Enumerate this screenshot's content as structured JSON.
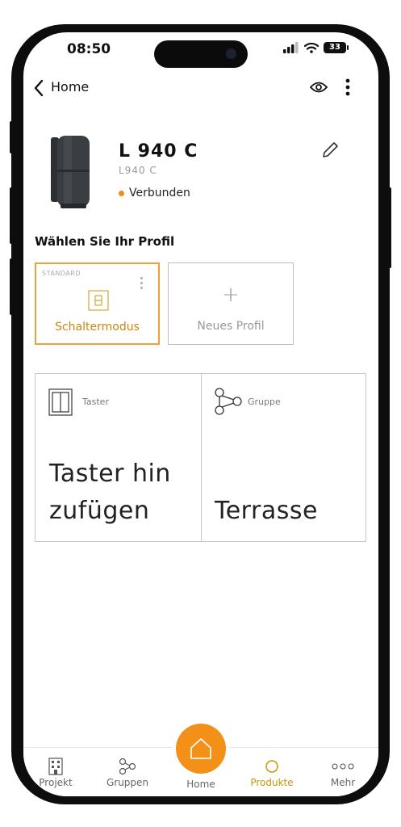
{
  "status_bar": {
    "time": "08:50",
    "battery": "33"
  },
  "nav": {
    "back_label": "Home",
    "eye_icon": "eye-icon",
    "menu_icon": "kebab-icon"
  },
  "device": {
    "name": "L 940 C",
    "model": "L940 C",
    "status": "Verbunden",
    "status_color": "#f08a1c"
  },
  "profile_section": {
    "title": "Wählen Sie Ihr Profil",
    "active": {
      "tag": "STANDARD",
      "label": "Schaltermodus"
    },
    "new_profile": {
      "symbol": "+",
      "label": "Neues Profil"
    }
  },
  "tiles": [
    {
      "small": "Taster",
      "big_line1": "Taster hin",
      "big_line2": "zufügen"
    },
    {
      "small": "Gruppe",
      "big_line1": "Terrasse"
    }
  ],
  "tabbar": {
    "items": [
      {
        "label": "Projekt",
        "icon": "building-icon"
      },
      {
        "label": "Gruppen",
        "icon": "group-icon"
      },
      {
        "label": "Home",
        "icon": "home-icon"
      },
      {
        "label": "Produkte",
        "icon": "circle-icon"
      },
      {
        "label": "Mehr",
        "icon": "more-icon"
      }
    ],
    "active": "Produkte"
  },
  "colors": {
    "accent": "#f29018",
    "active_text": "#c8960c",
    "profile_border": "#f0a03a"
  }
}
